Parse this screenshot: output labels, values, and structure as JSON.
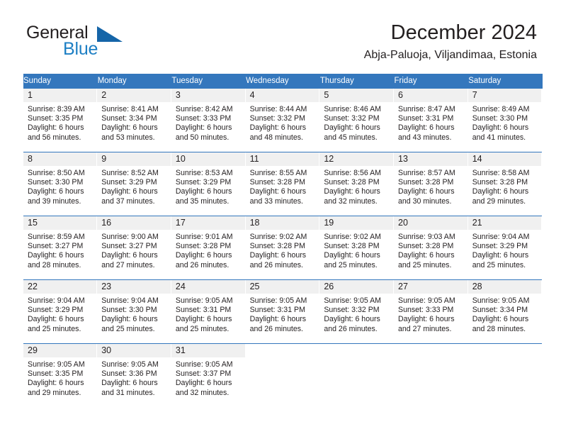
{
  "brand": {
    "name_part1": "General",
    "name_part2": "Blue",
    "triangle_color": "#1565a8",
    "blue_color": "#1d7fc4"
  },
  "header": {
    "title": "December 2024",
    "subtitle": "Abja-Paluoja, Viljandimaa, Estonia"
  },
  "theme": {
    "header_bg": "#3477bd",
    "header_text": "#ffffff",
    "daynum_band": "#f0f0f0",
    "text": "#231f20"
  },
  "weekdays": [
    "Sunday",
    "Monday",
    "Tuesday",
    "Wednesday",
    "Thursday",
    "Friday",
    "Saturday"
  ],
  "weeks": [
    [
      {
        "day": "1",
        "sunrise": "Sunrise: 8:39 AM",
        "sunset": "Sunset: 3:35 PM",
        "daylight1": "Daylight: 6 hours",
        "daylight2": "and 56 minutes."
      },
      {
        "day": "2",
        "sunrise": "Sunrise: 8:41 AM",
        "sunset": "Sunset: 3:34 PM",
        "daylight1": "Daylight: 6 hours",
        "daylight2": "and 53 minutes."
      },
      {
        "day": "3",
        "sunrise": "Sunrise: 8:42 AM",
        "sunset": "Sunset: 3:33 PM",
        "daylight1": "Daylight: 6 hours",
        "daylight2": "and 50 minutes."
      },
      {
        "day": "4",
        "sunrise": "Sunrise: 8:44 AM",
        "sunset": "Sunset: 3:32 PM",
        "daylight1": "Daylight: 6 hours",
        "daylight2": "and 48 minutes."
      },
      {
        "day": "5",
        "sunrise": "Sunrise: 8:46 AM",
        "sunset": "Sunset: 3:32 PM",
        "daylight1": "Daylight: 6 hours",
        "daylight2": "and 45 minutes."
      },
      {
        "day": "6",
        "sunrise": "Sunrise: 8:47 AM",
        "sunset": "Sunset: 3:31 PM",
        "daylight1": "Daylight: 6 hours",
        "daylight2": "and 43 minutes."
      },
      {
        "day": "7",
        "sunrise": "Sunrise: 8:49 AM",
        "sunset": "Sunset: 3:30 PM",
        "daylight1": "Daylight: 6 hours",
        "daylight2": "and 41 minutes."
      }
    ],
    [
      {
        "day": "8",
        "sunrise": "Sunrise: 8:50 AM",
        "sunset": "Sunset: 3:30 PM",
        "daylight1": "Daylight: 6 hours",
        "daylight2": "and 39 minutes."
      },
      {
        "day": "9",
        "sunrise": "Sunrise: 8:52 AM",
        "sunset": "Sunset: 3:29 PM",
        "daylight1": "Daylight: 6 hours",
        "daylight2": "and 37 minutes."
      },
      {
        "day": "10",
        "sunrise": "Sunrise: 8:53 AM",
        "sunset": "Sunset: 3:29 PM",
        "daylight1": "Daylight: 6 hours",
        "daylight2": "and 35 minutes."
      },
      {
        "day": "11",
        "sunrise": "Sunrise: 8:55 AM",
        "sunset": "Sunset: 3:28 PM",
        "daylight1": "Daylight: 6 hours",
        "daylight2": "and 33 minutes."
      },
      {
        "day": "12",
        "sunrise": "Sunrise: 8:56 AM",
        "sunset": "Sunset: 3:28 PM",
        "daylight1": "Daylight: 6 hours",
        "daylight2": "and 32 minutes."
      },
      {
        "day": "13",
        "sunrise": "Sunrise: 8:57 AM",
        "sunset": "Sunset: 3:28 PM",
        "daylight1": "Daylight: 6 hours",
        "daylight2": "and 30 minutes."
      },
      {
        "day": "14",
        "sunrise": "Sunrise: 8:58 AM",
        "sunset": "Sunset: 3:28 PM",
        "daylight1": "Daylight: 6 hours",
        "daylight2": "and 29 minutes."
      }
    ],
    [
      {
        "day": "15",
        "sunrise": "Sunrise: 8:59 AM",
        "sunset": "Sunset: 3:27 PM",
        "daylight1": "Daylight: 6 hours",
        "daylight2": "and 28 minutes."
      },
      {
        "day": "16",
        "sunrise": "Sunrise: 9:00 AM",
        "sunset": "Sunset: 3:27 PM",
        "daylight1": "Daylight: 6 hours",
        "daylight2": "and 27 minutes."
      },
      {
        "day": "17",
        "sunrise": "Sunrise: 9:01 AM",
        "sunset": "Sunset: 3:28 PM",
        "daylight1": "Daylight: 6 hours",
        "daylight2": "and 26 minutes."
      },
      {
        "day": "18",
        "sunrise": "Sunrise: 9:02 AM",
        "sunset": "Sunset: 3:28 PM",
        "daylight1": "Daylight: 6 hours",
        "daylight2": "and 26 minutes."
      },
      {
        "day": "19",
        "sunrise": "Sunrise: 9:02 AM",
        "sunset": "Sunset: 3:28 PM",
        "daylight1": "Daylight: 6 hours",
        "daylight2": "and 25 minutes."
      },
      {
        "day": "20",
        "sunrise": "Sunrise: 9:03 AM",
        "sunset": "Sunset: 3:28 PM",
        "daylight1": "Daylight: 6 hours",
        "daylight2": "and 25 minutes."
      },
      {
        "day": "21",
        "sunrise": "Sunrise: 9:04 AM",
        "sunset": "Sunset: 3:29 PM",
        "daylight1": "Daylight: 6 hours",
        "daylight2": "and 25 minutes."
      }
    ],
    [
      {
        "day": "22",
        "sunrise": "Sunrise: 9:04 AM",
        "sunset": "Sunset: 3:29 PM",
        "daylight1": "Daylight: 6 hours",
        "daylight2": "and 25 minutes."
      },
      {
        "day": "23",
        "sunrise": "Sunrise: 9:04 AM",
        "sunset": "Sunset: 3:30 PM",
        "daylight1": "Daylight: 6 hours",
        "daylight2": "and 25 minutes."
      },
      {
        "day": "24",
        "sunrise": "Sunrise: 9:05 AM",
        "sunset": "Sunset: 3:31 PM",
        "daylight1": "Daylight: 6 hours",
        "daylight2": "and 25 minutes."
      },
      {
        "day": "25",
        "sunrise": "Sunrise: 9:05 AM",
        "sunset": "Sunset: 3:31 PM",
        "daylight1": "Daylight: 6 hours",
        "daylight2": "and 26 minutes."
      },
      {
        "day": "26",
        "sunrise": "Sunrise: 9:05 AM",
        "sunset": "Sunset: 3:32 PM",
        "daylight1": "Daylight: 6 hours",
        "daylight2": "and 26 minutes."
      },
      {
        "day": "27",
        "sunrise": "Sunrise: 9:05 AM",
        "sunset": "Sunset: 3:33 PM",
        "daylight1": "Daylight: 6 hours",
        "daylight2": "and 27 minutes."
      },
      {
        "day": "28",
        "sunrise": "Sunrise: 9:05 AM",
        "sunset": "Sunset: 3:34 PM",
        "daylight1": "Daylight: 6 hours",
        "daylight2": "and 28 minutes."
      }
    ],
    [
      {
        "day": "29",
        "sunrise": "Sunrise: 9:05 AM",
        "sunset": "Sunset: 3:35 PM",
        "daylight1": "Daylight: 6 hours",
        "daylight2": "and 29 minutes."
      },
      {
        "day": "30",
        "sunrise": "Sunrise: 9:05 AM",
        "sunset": "Sunset: 3:36 PM",
        "daylight1": "Daylight: 6 hours",
        "daylight2": "and 31 minutes."
      },
      {
        "day": "31",
        "sunrise": "Sunrise: 9:05 AM",
        "sunset": "Sunset: 3:37 PM",
        "daylight1": "Daylight: 6 hours",
        "daylight2": "and 32 minutes."
      },
      {
        "day": "",
        "sunrise": "",
        "sunset": "",
        "daylight1": "",
        "daylight2": ""
      },
      {
        "day": "",
        "sunrise": "",
        "sunset": "",
        "daylight1": "",
        "daylight2": ""
      },
      {
        "day": "",
        "sunrise": "",
        "sunset": "",
        "daylight1": "",
        "daylight2": ""
      },
      {
        "day": "",
        "sunrise": "",
        "sunset": "",
        "daylight1": "",
        "daylight2": ""
      }
    ]
  ]
}
